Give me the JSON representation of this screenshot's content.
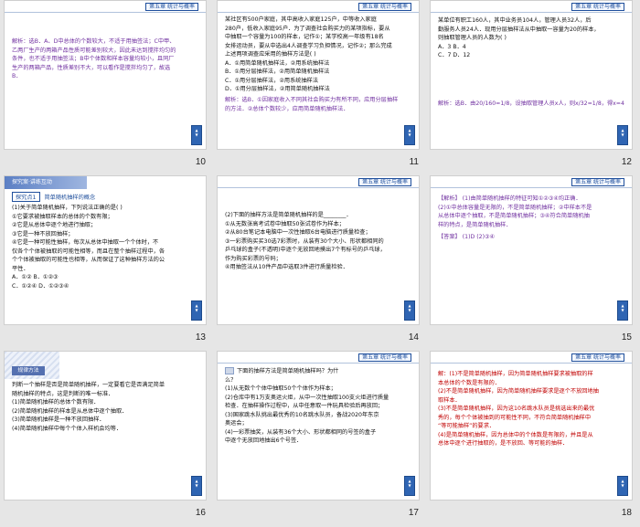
{
  "chapter_tag": "第五章 统计与概率",
  "slides": [
    {
      "num": "10",
      "lines": [
        "解析：选B．A、D中总体的个数较大，不适于用抽签法；C中甲、",
        "乙两厂生产的两箱产品性质可能差别较大，因此未达到搅拌均匀的",
        "条件，也不适于用抽签法；B中个体数和样本容量均较小，且同厂",
        "生产的两箱产品，性质差别不大，可以看作是搅拌均匀了，故选",
        "B．"
      ]
    },
    {
      "num": "11",
      "lines": [
        "某社区有500户家庭，其中高收入家庭125户，中等收入家庭",
        "280户，低收入家庭95户．为了调查社会购买力的某项指标，要从",
        "中抽取一个容量为100的样本，记作①；某学校高一年级有18名",
        "女排运动员，要从中选出4人调查学习负担情况，记作②；那么完成",
        "上述两项调查应采用的抽样方法是(   )",
        "A．①用简单随机抽样法，②用系统抽样法",
        "B．①用分层抽样法，②用简单随机抽样法",
        "C．①用分层抽样法，②用系统抽样法",
        "D．①用分层抽样法，②用简单随机抽样法"
      ],
      "answer_lines": [
        "解析：选B．①因家庭收入不同其社会购买力有所不同，应用分层抽样",
        "的方法．②总体个数较少，应用简单随机抽样法．"
      ]
    },
    {
      "num": "12",
      "lines": [
        "某单位有职工160人，其中业务员104人，管理人员32人，后",
        "勤服务人员24人．现用分层抽样法从中抽取一容量为20的样本，",
        "则抽取管理人员的人数为(   )",
        "A．3        B．4",
        "C．7        D．12"
      ],
      "answer": "解析：选B．由20/160=1/8，设抽取管理人员x人，则x/32=1/8，得x=4．"
    },
    {
      "num": "13",
      "banner": "探究案·讲练互动",
      "section_tag": "探究点1",
      "section_title": "简单随机抽样的概念",
      "lines": [
        "(1)关于简单随机抽样，下列说法正确的是(   )",
        "①它要求被抽取样本的总体的个数有限；",
        "②它是从总体中逐个地进行抽取；",
        "③它是一种不放回抽样；",
        "④它是一种可能性抽样，每次从总体中抽取一个个体时，不",
        "仅各个个体被抽取的可能性相等，而且在整个抽样过程中，各",
        "个个体被抽取的可能性也相等，从而保证了这种抽样方法的公",
        "平性．",
        "A．①②       B．①②③",
        "C．①②④      D．①②③④"
      ]
    },
    {
      "num": "14",
      "lines": [
        "(2)下面的抽样方法是简单随机抽样的是________．",
        "①从无数张高考试卷中抽取50张试卷作为样本；",
        "②从80台笔记本电脑中一次性抽取6台电脑进行质量检查；",
        "③一彩票购买买30选7彩票时，从装有30个大小、形状都相同的",
        "乒乓球的盒子(不透明)中逐个无放回地摸出7个有标号的乒乓球，",
        "作为购买彩票的号码；",
        "④用抽签法从10件产品中选取3件进行质量检验．"
      ]
    },
    {
      "num": "15",
      "lines": [
        "【解析】 (1)由简单随机抽样的特征可知①②③④均正确．",
        "(2)①中总体容量是无限的，不是简单随机抽样；②中样本不是",
        "从总体中逐个抽取，不是简单随机抽样；③④符合简单随机抽",
        "样的特点，是简单随机抽样．"
      ],
      "answer": "【答案】 (1)D  (2)③④"
    },
    {
      "num": "16",
      "method_title": "规律方法",
      "lines": [
        "判断一个抽样是否是简单随机抽样，一定要看它是否满足简单",
        "随机抽样的特点，这是判断的唯一标准．",
        "(1)简单随机抽样的总体个数有限．",
        "(2)简单随机抽样的样本是从总体中逐个抽取．",
        "(3)简单随机抽样是一种不放回抽样．",
        "(4)简单随机抽样中每个个体入样机会均等．"
      ]
    },
    {
      "num": "17",
      "lines": [
        "下面的抽样方法是简单随机抽样吗？为什",
        "么？",
        "(1)从无数个个体中抽取50个个体作为样本；",
        "(2)仓库中有1万支奥运火炬，从中一次性抽取100支火炬进行质量",
        "检查．在抽样操作过程中，从中任意取一件玩具检验后再放回；",
        "(3)国家跳水队挑出最优秀的10名跳水队员，备战2020年东京",
        "奥运会；",
        "(4)一彩票抽奖，从装有36个大小、形状都相同的号签的盒子",
        "中逐个无放回地抽出6个号签．"
      ]
    },
    {
      "num": "18",
      "lines": [
        "解：(1)不是简单随机抽样，因为简单随机抽样要求被抽取的样",
        "本总体的个数是有限的．",
        "(2)不是简单随机抽样，因为简单随机抽样要求是逐个不放回地抽",
        "取样本．",
        "(3)不是简单随机抽样，因为这10名跳水队员是挑选出来的最优",
        "秀的，每个个体被抽到的可能性不同，不符合简单随机抽样中",
        "“等可能抽样”的要求．",
        "(4)是简单随机抽样，因为总体中的个体数是有限的，并且是从",
        "总体中逐个进行抽取的，是不放回、等可能的抽样．"
      ]
    }
  ]
}
